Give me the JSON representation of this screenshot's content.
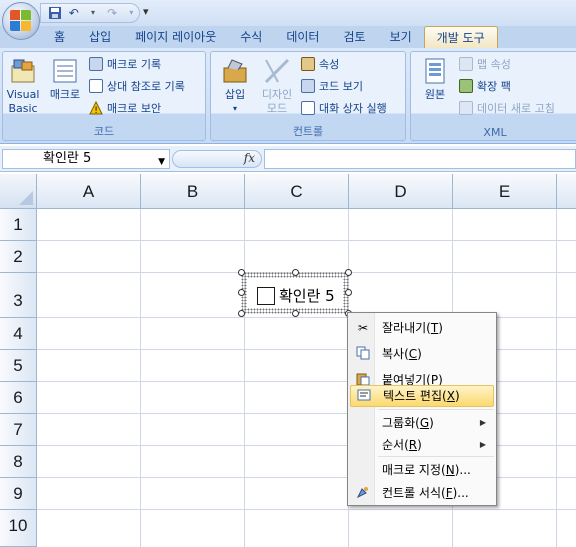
{
  "quick_access": {
    "save_icon": "save-icon",
    "undo_icon": "undo-icon",
    "redo_icon": "redo-icon",
    "more": "▾"
  },
  "tabs": [
    {
      "label": "홈"
    },
    {
      "label": "삽입"
    },
    {
      "label": "페이지 레이아웃"
    },
    {
      "label": "수식"
    },
    {
      "label": "데이터"
    },
    {
      "label": "검토"
    },
    {
      "label": "보기"
    },
    {
      "label": "개발 도구",
      "active": true
    }
  ],
  "ribbon": {
    "code": {
      "label": "코드",
      "visual_basic": "Visual Basic",
      "visual_basic_l1": "Visual",
      "visual_basic_l2": "Basic",
      "macro": "매크로",
      "record_macro": "매크로 기록",
      "relative_ref": "상대 참조로 기록",
      "macro_security": "매크로 보안"
    },
    "controls": {
      "label": "컨트롤",
      "insert": "삽입",
      "design_mode_l1": "디자인",
      "design_mode_l2": "모드",
      "properties": "속성",
      "view_code": "코드 보기",
      "run_dialog": "대화 상자 실행"
    },
    "xml": {
      "label": "XML",
      "source": "원본",
      "map_properties": "맵 속성",
      "expansion_pack": "확장 팩",
      "refresh_data": "데이터 새로 고침"
    }
  },
  "formula_bar": {
    "name_box": "확인란 5",
    "fx": "fx",
    "formula": ""
  },
  "grid": {
    "columns": [
      "A",
      "B",
      "C",
      "D",
      "E"
    ],
    "rows": [
      "1",
      "2",
      "3",
      "4",
      "5",
      "6",
      "7",
      "8",
      "9",
      "10"
    ]
  },
  "control": {
    "checkbox_label": "확인란 5",
    "checked": false
  },
  "context_menu": {
    "items": [
      {
        "label": "잘라내기",
        "key": "T",
        "icon": "scissors-icon"
      },
      {
        "label": "복사",
        "key": "C",
        "icon": "copy-icon"
      },
      {
        "label": "붙여넣기",
        "key": "P",
        "icon": "paste-icon"
      },
      {
        "label": "텍스트 편집",
        "key": "X",
        "icon": "edit-text-icon",
        "highlighted": true
      },
      {
        "label": "그룹화",
        "key": "G",
        "submenu": true
      },
      {
        "label": "순서",
        "key": "R",
        "submenu": true
      },
      {
        "label": "매크로 지정",
        "key": "N",
        "suffix": "..."
      },
      {
        "label": "컨트롤 서식",
        "key": "F",
        "suffix": "...",
        "icon": "format-control-icon"
      }
    ]
  },
  "colors": {
    "ribbon_text": "#15428b",
    "active_tab": "#f2e7c4",
    "menu_highlight": "#fbd96f",
    "grid_line": "#d0d7e5"
  }
}
